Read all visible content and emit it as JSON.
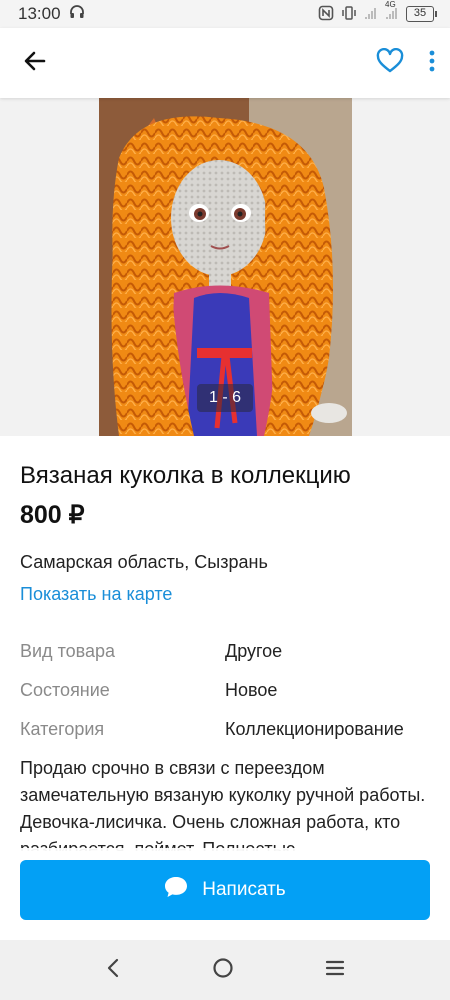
{
  "status_bar": {
    "time": "13:00",
    "battery": "35",
    "network": "4G",
    "icons": [
      "headphones-icon",
      "nfc-icon",
      "vibrate-icon",
      "signal-icon",
      "signal-icon",
      "battery-icon"
    ]
  },
  "app_bar": {
    "icons": [
      "back-arrow-icon",
      "heart-icon",
      "more-vert-icon"
    ],
    "accent_color": "#1a8ed8"
  },
  "gallery": {
    "counter": "1 - 6"
  },
  "listing": {
    "title": "Вязаная куколка в коллекцию",
    "price": "800 ₽",
    "location": "Самарская область, Сызрань",
    "map_link": "Показать на карте",
    "params": [
      {
        "key": "Вид товара",
        "value": "Другое"
      },
      {
        "key": "Состояние",
        "value": "Новое"
      },
      {
        "key": "Категория",
        "value": "Коллекционирование"
      }
    ],
    "description": "Продаю срочно в связи с переездом замечательную вязаную  куколку ручной работы. Девочка-лисичка.  Очень сложная работа, кто разбирается, поймет. Полностью"
  },
  "cta": {
    "label": "Написать",
    "icon": "chat-bubble-icon",
    "color": "#03a0f5"
  },
  "nav_bar": {
    "icons": [
      "nav-back-icon",
      "nav-home-icon",
      "nav-menu-icon"
    ]
  }
}
